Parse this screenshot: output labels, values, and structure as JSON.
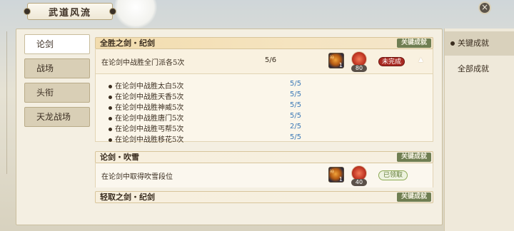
{
  "window": {
    "title": "武道风流",
    "close_icon": "×"
  },
  "tabs": [
    {
      "label": "论剑",
      "active": true
    },
    {
      "label": "战场",
      "active": false
    },
    {
      "label": "头衔",
      "active": false
    },
    {
      "label": "天龙战场",
      "active": false
    }
  ],
  "sections": [
    {
      "title": "全胜之剑・纪剑",
      "tag": "关键成就",
      "task": "在论剑中战胜全门派各5次",
      "progress": "5/6",
      "rewards": {
        "item_count": "1",
        "item_tag": "神",
        "coin_amount": "80"
      },
      "status": "未完成",
      "expanded": true,
      "subtasks": [
        {
          "label": "在论剑中战胜太白5次",
          "progress": "5/5"
        },
        {
          "label": "在论剑中战胜天香5次",
          "progress": "5/5"
        },
        {
          "label": "在论剑中战胜神威5次",
          "progress": "5/5"
        },
        {
          "label": "在论剑中战胜唐门5次",
          "progress": "5/5"
        },
        {
          "label": "在论剑中战胜丐帮5次",
          "progress": "2/5"
        },
        {
          "label": "在论剑中战胜移花5次",
          "progress": "5/5"
        }
      ]
    },
    {
      "title": "论剑・吹雪",
      "tag": "关键成就",
      "task": "在论剑中取得吹雪段位",
      "rewards": {
        "item_count": "1",
        "item_tag": "神",
        "coin_amount": "40"
      },
      "status": "已领取"
    },
    {
      "title": "轻取之剑・纪剑",
      "tag": "关键成就"
    }
  ],
  "right_menu": [
    {
      "label": "关键成就",
      "active": true
    },
    {
      "label": "全部成就",
      "active": false
    }
  ],
  "colors": {
    "unfinished": "#a92a22",
    "claimed": "#5f7a35",
    "subtask_progress": "#3a78b6",
    "key_tag": "#6f7e52"
  }
}
